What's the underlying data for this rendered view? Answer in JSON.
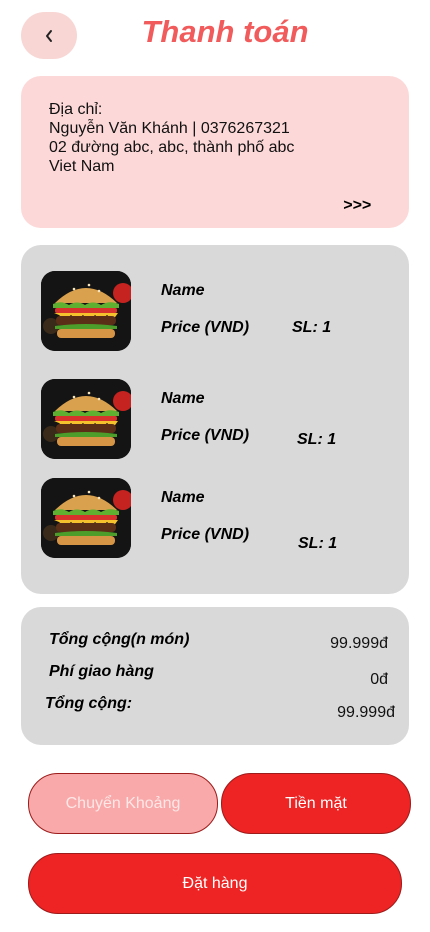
{
  "header": {
    "title": "Thanh toán"
  },
  "address": {
    "label": "Địa chỉ:",
    "name_phone": "Nguyễn Văn Khánh | 0376267321",
    "street": "02 đường abc, abc, thành phố abc",
    "country": "Viet Nam",
    "more": ">>>"
  },
  "items": [
    {
      "name": "Name",
      "price": "Price (VND)",
      "qty": "SL: 1"
    },
    {
      "name": "Name",
      "price": "Price (VND)",
      "qty": "SL: 1"
    },
    {
      "name": "Name",
      "price": "Price (VND)",
      "qty": "SL: 1"
    }
  ],
  "summary": {
    "subtotal_label": "Tổng cộng(n món)",
    "subtotal_value": "99.999đ",
    "shipping_label": "Phí giao hàng",
    "shipping_value": "0đ",
    "total_label": "Tổng cộng:",
    "total_value": "99.999đ"
  },
  "payment": {
    "transfer_label": "Chuyển Khoảng",
    "cash_label": "Tiền mặt"
  },
  "order": {
    "label": "Đặt hàng"
  },
  "colors": {
    "accent": "#ee2323",
    "title": "#f15b5b",
    "address_bg": "#fdd8d8",
    "card_bg": "#d9d9d9"
  }
}
